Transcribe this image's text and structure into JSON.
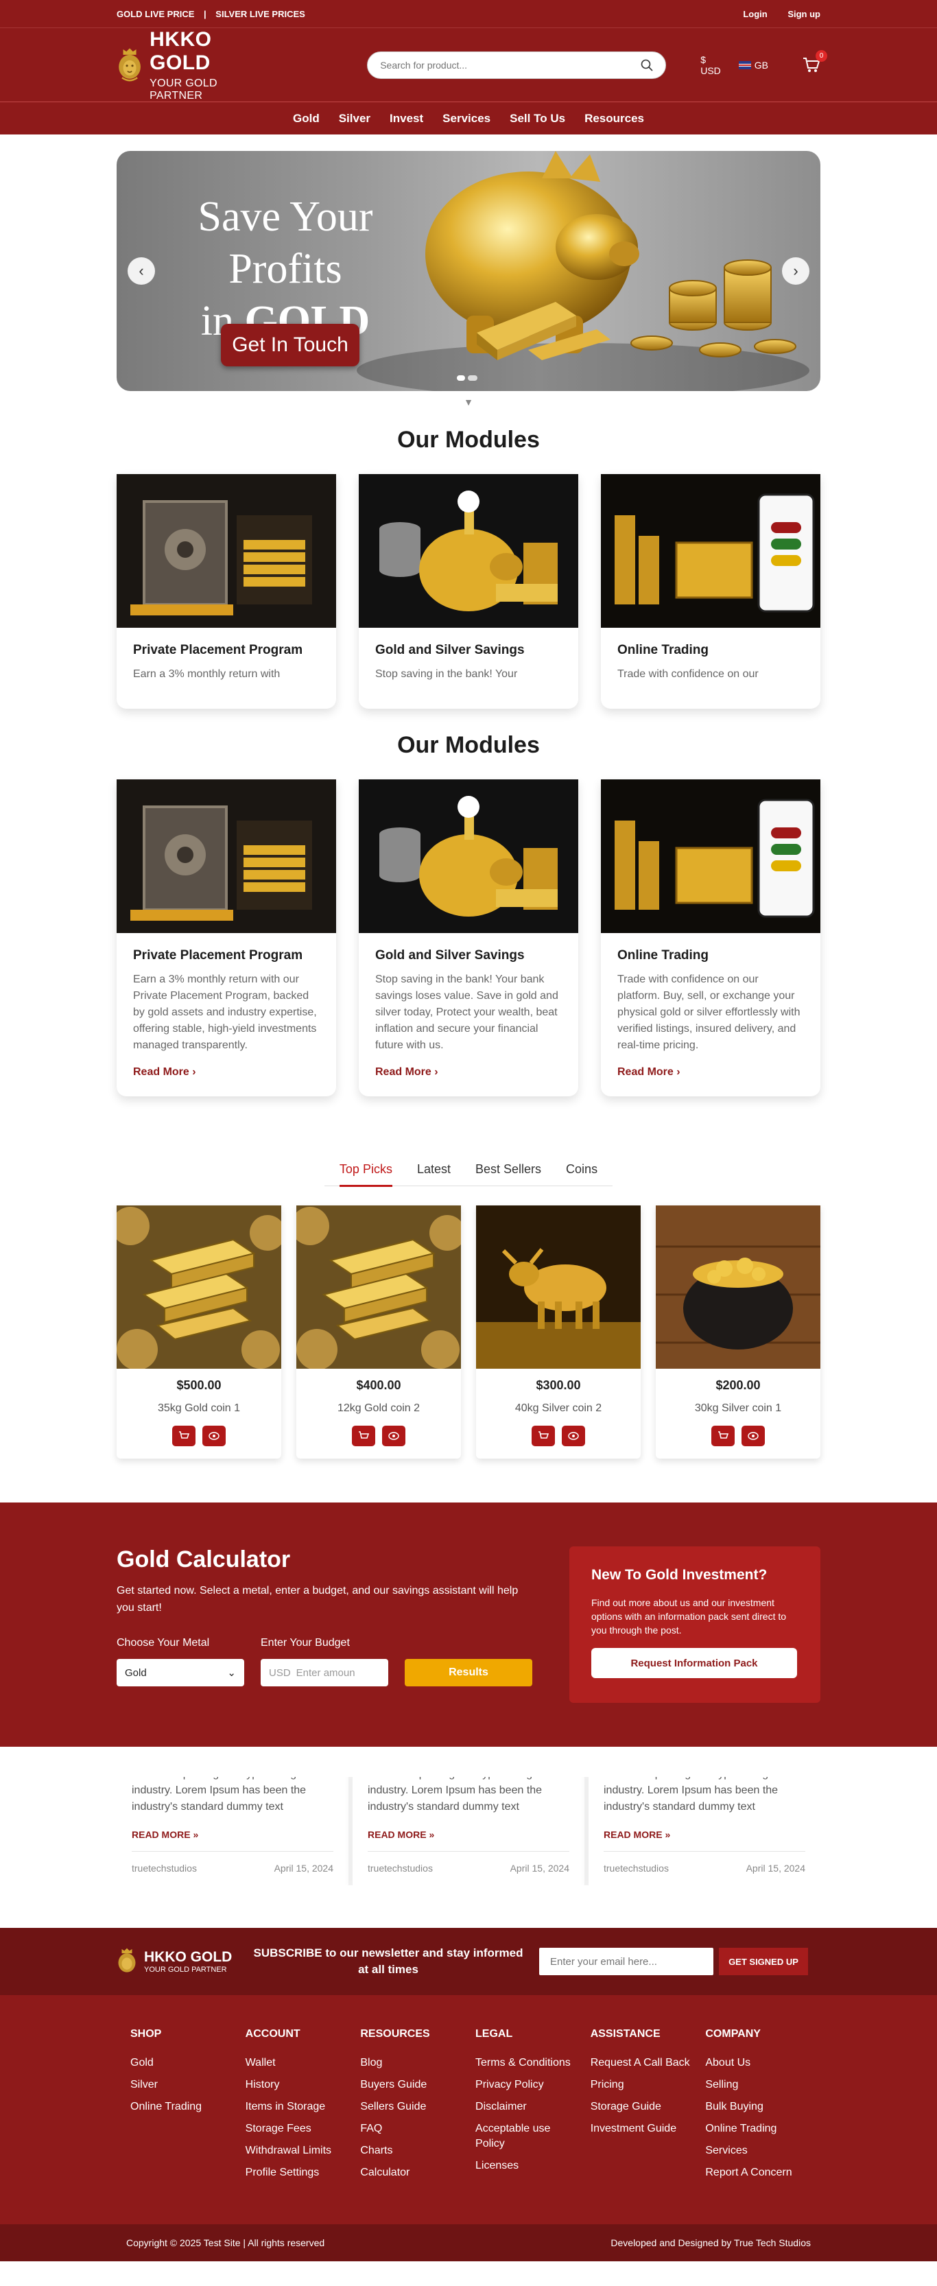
{
  "topbar": {
    "gold_live": "GOLD LIVE PRICE",
    "sep": "|",
    "silver_live": "SILVER LIVE PRICES",
    "login": "Login",
    "signup": "Sign up"
  },
  "header": {
    "brand": "HKKO GOLD",
    "tagline": "YOUR GOLD PARTNER",
    "search_placeholder": "Search for product...",
    "currency": "$ USD",
    "language": "GB",
    "cart_count": "0"
  },
  "nav": [
    "Gold",
    "Silver",
    "Invest",
    "Services",
    "Sell To Us",
    "Resources"
  ],
  "hero": {
    "line1": "Save Your Profits",
    "line2a": "in ",
    "line2b": "GOLD",
    "button": "Get In Touch"
  },
  "modules_title": "Our Modules",
  "modules": [
    {
      "title": "Private Placement Program",
      "text": "Earn a 3% monthly return with our Private Placement Program, backed by gold assets and industry expertise, offering stable, high-yield investments managed transparently.",
      "short": "Earn a 3% monthly return with",
      "more": "Read More"
    },
    {
      "title": "Gold and Silver Savings",
      "text": "Stop saving in the bank! Your bank savings loses value. Save in gold and silver today, Protect your wealth, beat inflation and secure your financial future with us.",
      "short": "Stop saving in the bank! Your",
      "more": "Read More"
    },
    {
      "title": "Online Trading",
      "text": "Trade with confidence on our platform. Buy, sell, or exchange your physical gold or silver effortlessly with verified listings, insured delivery, and real-time pricing.",
      "short": "Trade with confidence on our",
      "more": "Read More"
    }
  ],
  "tabs": [
    "Top Picks",
    "Latest",
    "Best Sellers",
    "Coins"
  ],
  "products": [
    {
      "price": "$500.00",
      "name": "35kg Gold coin 1"
    },
    {
      "price": "$400.00",
      "name": "12kg Gold coin 2"
    },
    {
      "price": "$300.00",
      "name": "40kg Silver coin 2"
    },
    {
      "price": "$200.00",
      "name": "30kg Silver coin 1"
    }
  ],
  "calculator": {
    "title": "Gold Calculator",
    "desc": "Get started now. Select a metal, enter a budget, and our savings assistant will help you start!",
    "metal_label": "Choose Your Metal",
    "metal_value": "Gold",
    "budget_label": "Enter Your Budget",
    "budget_prefix": "USD",
    "budget_placeholder": "Enter amoun",
    "results": "Results"
  },
  "new_invest": {
    "title": "New To Gold Investment?",
    "text": "Find out more about us and our investment options with an information pack sent direct to you through the post.",
    "button": "Request Information Pack"
  },
  "blogs": [
    {
      "text": "text of the printing and typesetting industry. Lorem Ipsum has been the industry's standard dummy text",
      "more": "READ MORE »",
      "author": "truetechstudios",
      "date": "April 15, 2024"
    },
    {
      "text": "text of the printing and typesetting industry. Lorem Ipsum has been the industry's standard dummy text",
      "more": "READ MORE »",
      "author": "truetechstudios",
      "date": "April 15, 2024"
    },
    {
      "text": "text of the printing and typesetting industry. Lorem Ipsum has been the industry's standard dummy text",
      "more": "READ MORE »",
      "author": "truetechstudios",
      "date": "April 15, 2024"
    }
  ],
  "subscribe": {
    "text": "SUBSCRIBE to our newsletter and stay informed at all times",
    "placeholder": "Enter your email here...",
    "button": "GET SIGNED UP"
  },
  "footer": {
    "cols": [
      {
        "title": "SHOP",
        "items": [
          "Gold",
          "Silver",
          "Online Trading"
        ]
      },
      {
        "title": "ACCOUNT",
        "items": [
          "Wallet",
          "History",
          "Items in Storage",
          "Storage Fees",
          "Withdrawal Limits",
          "Profile Settings"
        ]
      },
      {
        "title": "RESOURCES",
        "items": [
          "Blog",
          "Buyers Guide",
          "Sellers Guide",
          "FAQ",
          "Charts",
          "Calculator"
        ]
      },
      {
        "title": "LEGAL",
        "items": [
          "Terms & Conditions",
          "Privacy Policy",
          "Disclaimer",
          "Acceptable use Policy",
          "Licenses"
        ]
      },
      {
        "title": "ASSISTANCE",
        "items": [
          "Request A Call Back",
          "Pricing",
          "Storage Guide",
          "Investment Guide"
        ]
      },
      {
        "title": "COMPANY",
        "items": [
          "About Us",
          "Selling",
          "Bulk Buying",
          "Online Trading",
          "Services",
          "Report A Concern"
        ]
      }
    ],
    "copyright": "Copyright © 2025 Test Site | All rights reserved",
    "credit": "Developed and Designed by True Tech Studios"
  }
}
